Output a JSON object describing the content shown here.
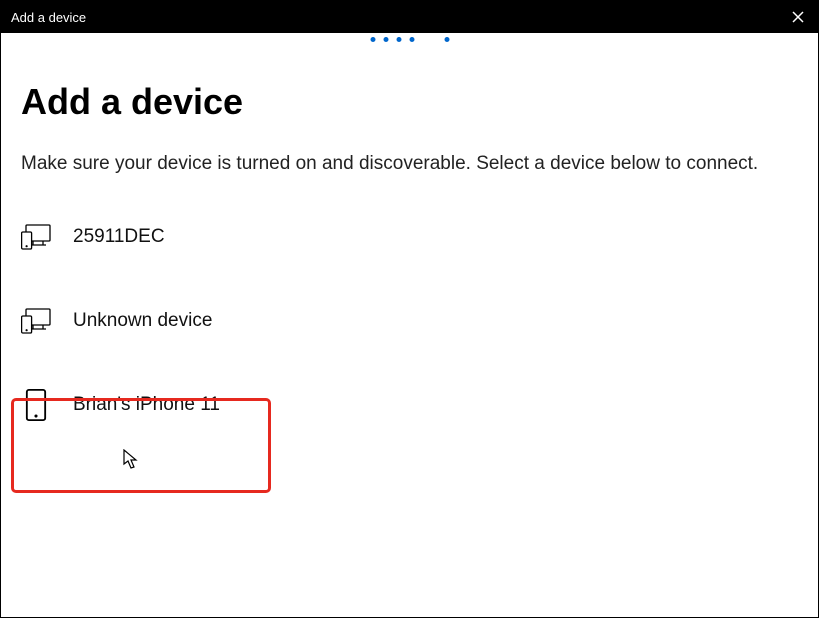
{
  "titlebar": {
    "title": "Add a device"
  },
  "heading": "Add a device",
  "instruction": "Make sure your device is turned on and discoverable. Select a device below to connect.",
  "devices": [
    {
      "name": "25911DEC",
      "icon": "monitor-phone"
    },
    {
      "name": "Unknown device",
      "icon": "monitor-phone"
    },
    {
      "name": "Brian's iPhone 11",
      "icon": "phone"
    }
  ]
}
